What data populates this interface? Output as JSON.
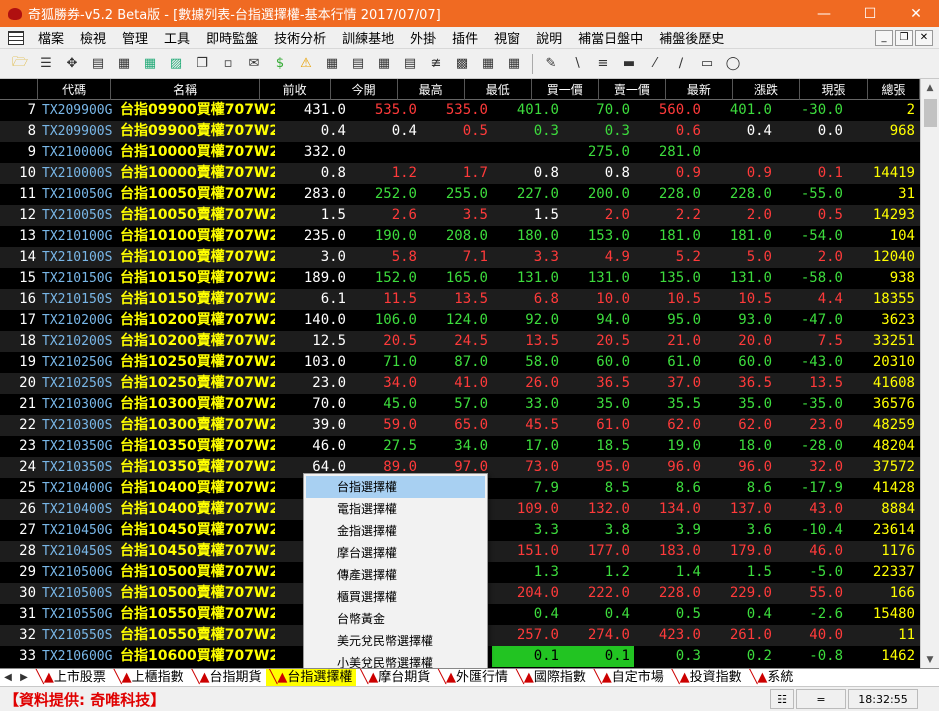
{
  "window": {
    "title": "奇狐勝券-v5.2 Beta版 - [數據列表-台指選擇權-基本行情 2017/07/07]"
  },
  "menu": [
    "檔案",
    "檢視",
    "管理",
    "工具",
    "即時監盤",
    "技術分析",
    "訓練基地",
    "外掛",
    "插件",
    "視窗",
    "說明",
    "補當日盤中",
    "補盤後歷史"
  ],
  "columns": [
    "代碼",
    "名稱",
    "前收",
    "今開",
    "最高",
    "最低",
    "買一價",
    "賣一價",
    "最新",
    "漲跌",
    "現張",
    "總張"
  ],
  "rows": [
    {
      "n": "7",
      "code": "TX209900G",
      "name": "台指09900買權707W2",
      "prev": "431.0",
      "open": "535.0",
      "high": "535.0",
      "low": "401.0",
      "bid": "70.0",
      "ask": "560.0",
      "last": "401.0",
      "chg": "-30.0",
      "vol": "2",
      "tot": "2",
      "s": [
        "up",
        "up",
        "dn",
        "dn",
        "up",
        "dn",
        "dn"
      ]
    },
    {
      "n": "8",
      "code": "TX209900S",
      "name": "台指09900賣權707W2",
      "prev": "0.4",
      "open": "0.4",
      "high": "0.5",
      "low": "0.3",
      "bid": "0.3",
      "ask": "0.6",
      "last": "0.4",
      "chg": "0.0",
      "vol": "968",
      "tot": "968",
      "s": [
        "fl",
        "up",
        "dn",
        "dn",
        "up",
        "fl",
        "fl"
      ]
    },
    {
      "n": "9",
      "code": "TX210000G",
      "name": "台指10000買權707W2",
      "prev": "332.0",
      "open": "",
      "high": "",
      "low": "",
      "bid": "275.0",
      "ask": "281.0",
      "last": "",
      "chg": "",
      "vol": "",
      "tot": "",
      "s": [
        "fl",
        "fl",
        "fl",
        "dn",
        "dn",
        "fl",
        "fl"
      ]
    },
    {
      "n": "10",
      "code": "TX210000S",
      "name": "台指10000賣權707W2",
      "prev": "0.8",
      "open": "1.2",
      "high": "1.7",
      "low": "0.8",
      "bid": "0.8",
      "ask": "0.9",
      "last": "0.9",
      "chg": "0.1",
      "vol": "14419",
      "tot": "14419",
      "s": [
        "up",
        "up",
        "fl",
        "fl",
        "up",
        "up",
        "up"
      ]
    },
    {
      "n": "11",
      "code": "TX210050G",
      "name": "台指10050買權707W2",
      "prev": "283.0",
      "open": "252.0",
      "high": "255.0",
      "low": "227.0",
      "bid": "200.0",
      "ask": "228.0",
      "last": "228.0",
      "chg": "-55.0",
      "vol": "31",
      "tot": "31",
      "s": [
        "dn",
        "dn",
        "dn",
        "dn",
        "dn",
        "dn",
        "dn"
      ]
    },
    {
      "n": "12",
      "code": "TX210050S",
      "name": "台指10050賣權707W2",
      "prev": "1.5",
      "open": "2.6",
      "high": "3.5",
      "low": "1.5",
      "bid": "2.0",
      "ask": "2.2",
      "last": "2.0",
      "chg": "0.5",
      "vol": "14293",
      "tot": "14293",
      "s": [
        "up",
        "up",
        "fl",
        "up",
        "up",
        "up",
        "up"
      ]
    },
    {
      "n": "13",
      "code": "TX210100G",
      "name": "台指10100買權707W2",
      "prev": "235.0",
      "open": "190.0",
      "high": "208.0",
      "low": "180.0",
      "bid": "153.0",
      "ask": "181.0",
      "last": "181.0",
      "chg": "-54.0",
      "vol": "104",
      "tot": "104",
      "s": [
        "dn",
        "dn",
        "dn",
        "dn",
        "dn",
        "dn",
        "dn"
      ]
    },
    {
      "n": "14",
      "code": "TX210100S",
      "name": "台指10100賣權707W2",
      "prev": "3.0",
      "open": "5.8",
      "high": "7.1",
      "low": "3.3",
      "bid": "4.9",
      "ask": "5.2",
      "last": "5.0",
      "chg": "2.0",
      "vol": "12040",
      "tot": "12040",
      "s": [
        "up",
        "up",
        "up",
        "up",
        "up",
        "up",
        "up"
      ]
    },
    {
      "n": "15",
      "code": "TX210150G",
      "name": "台指10150買權707W2",
      "prev": "189.0",
      "open": "152.0",
      "high": "165.0",
      "low": "131.0",
      "bid": "131.0",
      "ask": "135.0",
      "last": "131.0",
      "chg": "-58.0",
      "vol": "938",
      "tot": "938",
      "s": [
        "dn",
        "dn",
        "dn",
        "dn",
        "dn",
        "dn",
        "dn"
      ]
    },
    {
      "n": "16",
      "code": "TX210150S",
      "name": "台指10150賣權707W2",
      "prev": "6.1",
      "open": "11.5",
      "high": "13.5",
      "low": "6.8",
      "bid": "10.0",
      "ask": "10.5",
      "last": "10.5",
      "chg": "4.4",
      "vol": "18355",
      "tot": "18355",
      "s": [
        "up",
        "up",
        "up",
        "up",
        "up",
        "up",
        "up"
      ]
    },
    {
      "n": "17",
      "code": "TX210200G",
      "name": "台指10200買權707W2",
      "prev": "140.0",
      "open": "106.0",
      "high": "124.0",
      "low": "92.0",
      "bid": "94.0",
      "ask": "95.0",
      "last": "93.0",
      "chg": "-47.0",
      "vol": "3623",
      "tot": "3623",
      "s": [
        "dn",
        "dn",
        "dn",
        "dn",
        "dn",
        "dn",
        "dn"
      ]
    },
    {
      "n": "18",
      "code": "TX210200S",
      "name": "台指10200賣權707W2",
      "prev": "12.5",
      "open": "20.5",
      "high": "24.5",
      "low": "13.5",
      "bid": "20.5",
      "ask": "21.0",
      "last": "20.0",
      "chg": "7.5",
      "vol": "33251",
      "tot": "33251",
      "s": [
        "up",
        "up",
        "up",
        "up",
        "up",
        "up",
        "up"
      ]
    },
    {
      "n": "19",
      "code": "TX210250G",
      "name": "台指10250買權707W2",
      "prev": "103.0",
      "open": "71.0",
      "high": "87.0",
      "low": "58.0",
      "bid": "60.0",
      "ask": "61.0",
      "last": "60.0",
      "chg": "-43.0",
      "vol": "20310",
      "tot": "20310",
      "s": [
        "dn",
        "dn",
        "dn",
        "dn",
        "dn",
        "dn",
        "dn"
      ]
    },
    {
      "n": "20",
      "code": "TX210250S",
      "name": "台指10250賣權707W2",
      "prev": "23.0",
      "open": "34.0",
      "high": "41.0",
      "low": "26.0",
      "bid": "36.5",
      "ask": "37.0",
      "last": "36.5",
      "chg": "13.5",
      "vol": "41608",
      "tot": "41608",
      "s": [
        "up",
        "up",
        "up",
        "up",
        "up",
        "up",
        "up"
      ]
    },
    {
      "n": "21",
      "code": "TX210300G",
      "name": "台指10300買權707W2",
      "prev": "70.0",
      "open": "45.0",
      "high": "57.0",
      "low": "33.0",
      "bid": "35.0",
      "ask": "35.5",
      "last": "35.0",
      "chg": "-35.0",
      "vol": "36576",
      "tot": "36576",
      "s": [
        "dn",
        "dn",
        "dn",
        "dn",
        "dn",
        "dn",
        "dn"
      ]
    },
    {
      "n": "22",
      "code": "TX210300S",
      "name": "台指10300賣權707W2",
      "prev": "39.0",
      "open": "59.0",
      "high": "65.0",
      "low": "45.5",
      "bid": "61.0",
      "ask": "62.0",
      "last": "62.0",
      "chg": "23.0",
      "vol": "48259",
      "tot": "48259",
      "s": [
        "up",
        "up",
        "up",
        "up",
        "up",
        "up",
        "up"
      ]
    },
    {
      "n": "23",
      "code": "TX210350G",
      "name": "台指10350買權707W2",
      "prev": "46.0",
      "open": "27.5",
      "high": "34.0",
      "low": "17.0",
      "bid": "18.5",
      "ask": "19.0",
      "last": "18.0",
      "chg": "-28.0",
      "vol": "48204",
      "tot": "48204",
      "s": [
        "dn",
        "dn",
        "dn",
        "dn",
        "dn",
        "dn",
        "dn"
      ]
    },
    {
      "n": "24",
      "code": "TX210350S",
      "name": "台指10350賣權707W2",
      "prev": "64.0",
      "open": "89.0",
      "high": "97.0",
      "low": "73.0",
      "bid": "95.0",
      "ask": "96.0",
      "last": "96.0",
      "chg": "32.0",
      "vol": "37572",
      "tot": "37572",
      "s": [
        "up",
        "up",
        "up",
        "up",
        "up",
        "up",
        "up"
      ]
    },
    {
      "n": "25",
      "code": "TX210400G",
      "name": "台指10400買權707W2",
      "prev": "",
      "open": "",
      "high": "",
      "low": "7.9",
      "bid": "8.5",
      "ask": "8.6",
      "last": "8.6",
      "chg": "-17.9",
      "vol": "41428",
      "tot": "41428",
      "s": [
        "fl",
        "fl",
        "dn",
        "dn",
        "dn",
        "dn",
        "dn"
      ]
    },
    {
      "n": "26",
      "code": "TX210400S",
      "name": "台指10400賣權707W2",
      "prev": "",
      "open": "",
      "high": "",
      "low": "109.0",
      "bid": "132.0",
      "ask": "134.0",
      "last": "137.0",
      "chg": "43.0",
      "vol": "8884",
      "tot": "8884",
      "s": [
        "fl",
        "fl",
        "up",
        "up",
        "up",
        "up",
        "up"
      ]
    },
    {
      "n": "27",
      "code": "TX210450G",
      "name": "台指10450買權707W2",
      "prev": "",
      "open": "",
      "high": "",
      "low": "3.3",
      "bid": "3.8",
      "ask": "3.9",
      "last": "3.6",
      "chg": "-10.4",
      "vol": "23614",
      "tot": "23614",
      "s": [
        "fl",
        "fl",
        "dn",
        "dn",
        "dn",
        "dn",
        "dn"
      ]
    },
    {
      "n": "28",
      "code": "TX210450S",
      "name": "台指10450賣權707W2",
      "prev": "",
      "open": "",
      "high": "",
      "low": "151.0",
      "bid": "177.0",
      "ask": "183.0",
      "last": "179.0",
      "chg": "46.0",
      "vol": "1176",
      "tot": "1176",
      "s": [
        "fl",
        "fl",
        "up",
        "up",
        "up",
        "up",
        "up"
      ]
    },
    {
      "n": "29",
      "code": "TX210500G",
      "name": "台指10500買權707W2",
      "prev": "",
      "open": "",
      "high": "",
      "low": "1.3",
      "bid": "1.2",
      "ask": "1.4",
      "last": "1.5",
      "chg": "-5.0",
      "vol": "22337",
      "tot": "22337",
      "s": [
        "fl",
        "fl",
        "dn",
        "dn",
        "dn",
        "dn",
        "dn"
      ]
    },
    {
      "n": "30",
      "code": "TX210500S",
      "name": "台指10500賣權707W2",
      "prev": "",
      "open": "",
      "high": "",
      "low": "204.0",
      "bid": "222.0",
      "ask": "228.0",
      "last": "229.0",
      "chg": "55.0",
      "vol": "166",
      "tot": "166",
      "s": [
        "fl",
        "fl",
        "up",
        "up",
        "up",
        "up",
        "up"
      ]
    },
    {
      "n": "31",
      "code": "TX210550G",
      "name": "台指10550買權707W2",
      "prev": "",
      "open": "",
      "high": "",
      "low": "0.4",
      "bid": "0.4",
      "ask": "0.5",
      "last": "0.4",
      "chg": "-2.6",
      "vol": "15480",
      "tot": "15480",
      "s": [
        "fl",
        "fl",
        "dn",
        "dn",
        "dn",
        "dn",
        "dn"
      ]
    },
    {
      "n": "32",
      "code": "TX210550S",
      "name": "台指10550賣權707W2",
      "prev": "",
      "open": "",
      "high": "",
      "low": "257.0",
      "bid": "274.0",
      "ask": "423.0",
      "last": "261.0",
      "chg": "40.0",
      "vol": "11",
      "tot": "11",
      "s": [
        "fl",
        "fl",
        "up",
        "up",
        "up",
        "up",
        "up"
      ]
    },
    {
      "n": "33",
      "code": "TX210600G",
      "name": "台指10600買權707W2",
      "prev": "",
      "open": "",
      "high": "",
      "low": "0.1",
      "bid": "0.1",
      "ask": "0.3",
      "last": "0.2",
      "chg": "-0.8",
      "vol": "1462",
      "tot": "1462",
      "s": [
        "fl",
        "fl",
        "hl",
        "hl",
        "dn",
        "dn",
        "dn"
      ]
    }
  ],
  "popup": [
    "台指選擇權",
    "電指選擇權",
    "金指選擇權",
    "摩台選擇權",
    "傳產選擇權",
    "櫃買選擇權",
    "台幣黃金",
    "美元兌民幣選擇權",
    "小美兌民幣選擇權"
  ],
  "tabs": [
    "上市股票",
    "上櫃指數",
    "台指期貨",
    "台指選擇權",
    "摩台期貨",
    "外匯行情",
    "國際指數",
    "自定市場",
    "投資指數",
    "系統"
  ],
  "active_tab": 3,
  "status": {
    "provider": "【資料提供: 奇唯科技】",
    "time": "18:32:55"
  },
  "colors": {
    "title_bar": "#f06a22",
    "up": "#ff3a3a",
    "down": "#3ddc3d",
    "name": "#ffff00",
    "code": "#79b7e8"
  }
}
